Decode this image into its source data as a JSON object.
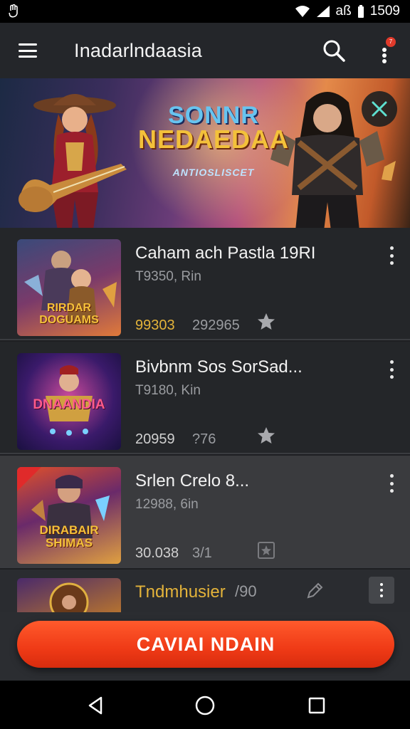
{
  "status_bar": {
    "text": "aß",
    "time": "1509"
  },
  "app_bar": {
    "title": "Inadarlndaasia",
    "notification_count": "7"
  },
  "banner": {
    "title_line1": "SONNR",
    "title_line2": "NEDAEDAA",
    "subtitle": "ANTIOSLISCET"
  },
  "games": [
    {
      "title": "Caham ach Pastla 19RI",
      "subtitle": "T9350, Rin",
      "stat1": "99303",
      "stat2": "292965",
      "thumb_title": "RIRDAR DOGUAMS"
    },
    {
      "title": "Bivbnm Sos SorSad...",
      "subtitle": "T9180, Kin",
      "stat1": "20959",
      "stat2": "?76",
      "thumb_title": "DNAANDIA"
    },
    {
      "title": "Srlen Crelo 8...",
      "subtitle": "12988, 6in",
      "stat1": "30.038",
      "stat2": "3/1",
      "thumb_title": "DIRABAIR SHIMAS"
    },
    {
      "title": "Tndmhusier",
      "stat2": "/90"
    }
  ],
  "cta": {
    "label": "CAVIAI NDAIN"
  },
  "colors": {
    "accent": "#ef3a16",
    "highlight": "#e3b33a",
    "background": "#242629"
  }
}
